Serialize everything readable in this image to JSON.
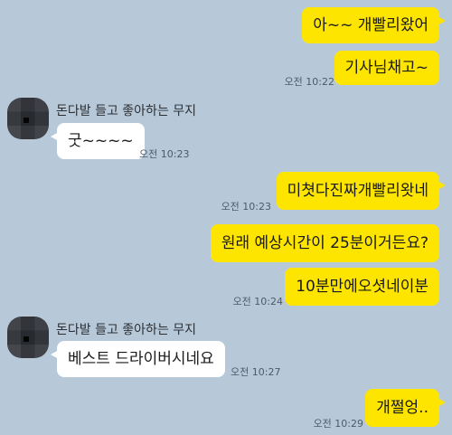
{
  "messages": [
    {
      "text": "아~~ 개빨리왔어",
      "time": ""
    },
    {
      "text": "기사님채고~",
      "time": "오전 10:22"
    },
    {
      "sender": "돈다발 들고 좋아하는 무지",
      "text": "굿~~~~",
      "time": "오전 10:23"
    },
    {
      "text": "미쳣다진짜개빨리왓네",
      "time": "오전 10:23"
    },
    {
      "text": "원래 예상시간이 25분이거든요?",
      "time": ""
    },
    {
      "text": "10분만에오셧네이분",
      "time": "오전 10:24"
    },
    {
      "sender": "돈다발 들고 좋아하는 무지",
      "text": "베스트 드라이버시네요",
      "time": "오전 10:27"
    },
    {
      "text": "개쩔엉..",
      "time": "오전 10:29"
    }
  ],
  "colors": {
    "background": "#b7c9d9",
    "outgoing_bubble": "#fee500",
    "incoming_bubble": "#ffffff"
  },
  "icons": {
    "avatar": "pixelated-profile-avatar"
  }
}
